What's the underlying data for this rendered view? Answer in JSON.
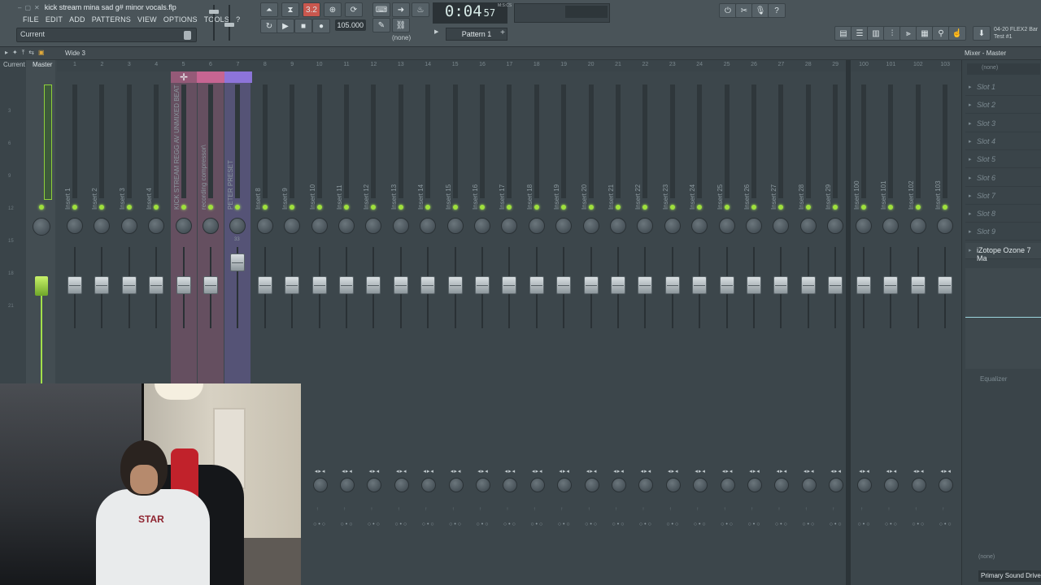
{
  "window": {
    "file_title": "kick stream mina sad g# minor vocals.flp",
    "controls": [
      "–",
      "▢",
      "✕"
    ]
  },
  "menu": [
    "FILE",
    "EDIT",
    "ADD",
    "PATTERNS",
    "VIEW",
    "OPTIONS",
    "TOOLS",
    "?"
  ],
  "hint_bar": {
    "text": "Current"
  },
  "transport": {
    "time_main": "0:04",
    "time_ms": "57",
    "time_unit": "M:S:CS",
    "bpm": "105.000",
    "pattern_label": "Pattern 1",
    "pattern_none": "(none)",
    "step_mode": "3.2"
  },
  "flex_info": {
    "line1": "04-20  FLEX2 Bar",
    "line2": "Test #1"
  },
  "mixer_header": {
    "layout_name": "Wide 3",
    "title": "Mixer - Master",
    "current_label": "Current",
    "master_label": "Master"
  },
  "ruler": [
    "3",
    "6",
    "9",
    "12",
    "15",
    "18",
    "21"
  ],
  "tracks": [
    {
      "num": "1",
      "name": "Insert 1"
    },
    {
      "num": "2",
      "name": "Insert 2"
    },
    {
      "num": "3",
      "name": "Insert 3"
    },
    {
      "num": "4",
      "name": "Insert 4"
    },
    {
      "num": "5",
      "name": "KICK STREAM REGG AV UNMIXED BEAT"
    },
    {
      "num": "6",
      "name": "recording compressor\\"
    },
    {
      "num": "7",
      "name": "PETER PRESET"
    },
    {
      "num": "8",
      "name": "Insert 8"
    },
    {
      "num": "9",
      "name": "Insert 9"
    },
    {
      "num": "10",
      "name": "Insert 10"
    },
    {
      "num": "11",
      "name": "Insert 11"
    },
    {
      "num": "12",
      "name": "Insert 12"
    },
    {
      "num": "13",
      "name": "Insert 13"
    },
    {
      "num": "14",
      "name": "Insert 14"
    },
    {
      "num": "15",
      "name": "Insert 15"
    },
    {
      "num": "16",
      "name": "Insert 16"
    },
    {
      "num": "17",
      "name": "Insert 17"
    },
    {
      "num": "18",
      "name": "Insert 18"
    },
    {
      "num": "19",
      "name": "Insert 19"
    },
    {
      "num": "20",
      "name": "Insert 20"
    },
    {
      "num": "21",
      "name": "Insert 21"
    },
    {
      "num": "22",
      "name": "Insert 22"
    },
    {
      "num": "23",
      "name": "Insert 23"
    },
    {
      "num": "24",
      "name": "Insert 24"
    },
    {
      "num": "25",
      "name": "Insert 25"
    },
    {
      "num": "26",
      "name": "Insert 26"
    },
    {
      "num": "27",
      "name": "Insert 27"
    },
    {
      "num": "28",
      "name": "Insert 28"
    },
    {
      "num": "29",
      "name": "Insert 29"
    }
  ],
  "extra_tracks": [
    {
      "num": "100",
      "name": "Insert 100"
    },
    {
      "num": "101",
      "name": "Insert 101"
    },
    {
      "num": "102",
      "name": "Insert 102"
    },
    {
      "num": "103",
      "name": "Insert 103"
    }
  ],
  "peter_value": "33",
  "master_name": "Master",
  "side_panel": {
    "input_none": "(none)",
    "slots": [
      "Slot 1",
      "Slot 2",
      "Slot 3",
      "Slot 4",
      "Slot 5",
      "Slot 6",
      "Slot 7",
      "Slot 8",
      "Slot 9"
    ],
    "active_plugin": "iZotope Ozone 7 Ma",
    "eq_label": "Equalizer",
    "output_none": "(none)",
    "output_device": "Primary Sound Drive"
  },
  "webcam": {
    "shirt_text": "STAR"
  },
  "colors": {
    "accent_green": "#9fe03c",
    "select_pink": "#c46591",
    "select_purple": "#8a74d6"
  }
}
